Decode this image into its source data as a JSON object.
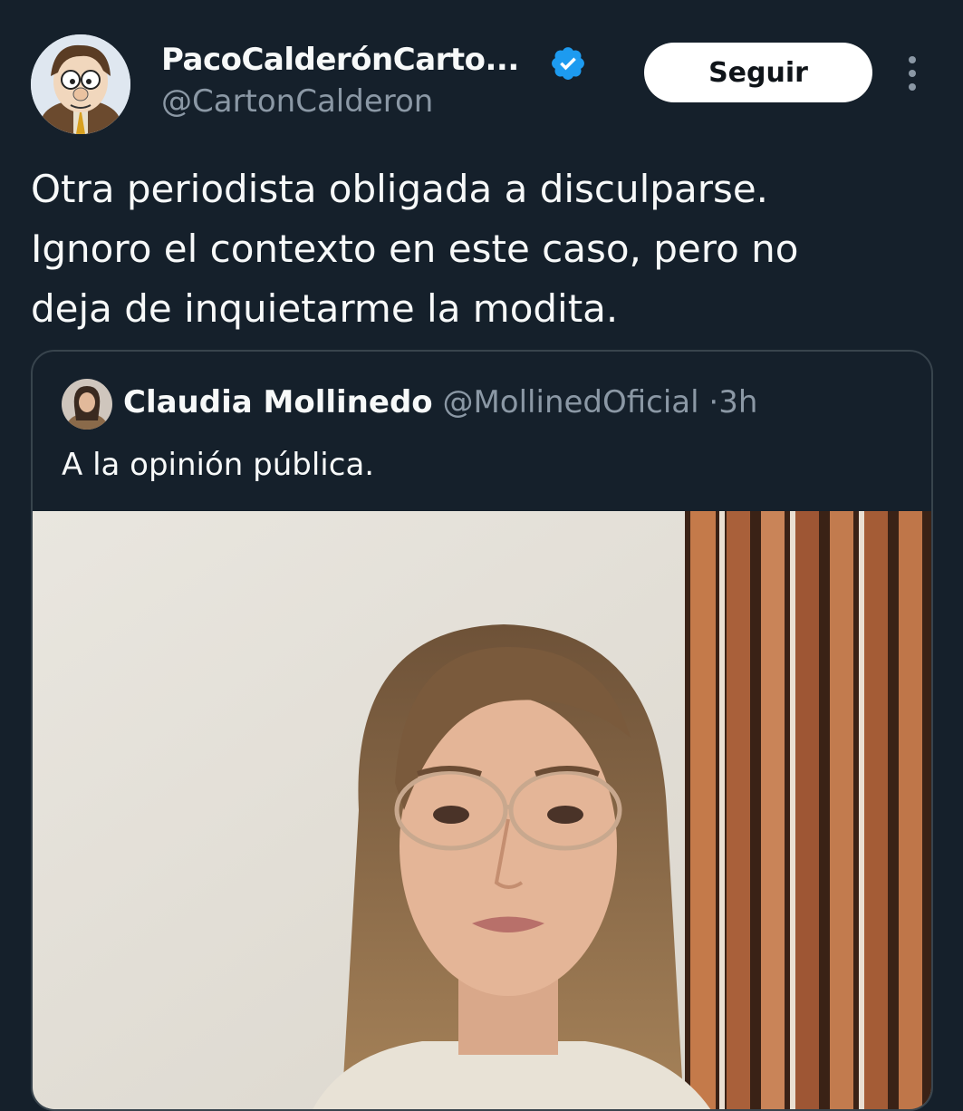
{
  "author": {
    "display_name": "PacoCalderónCarto...",
    "handle": "@CartonCalderon",
    "verified": true
  },
  "follow_button": {
    "label": "Seguir"
  },
  "more_button": {
    "icon": "more-vertical-icon"
  },
  "tweet": {
    "text_lines": [
      "Otra periodista obligada a disculparse.",
      "Ignoro el contexto en este caso, pero no",
      "deja de inquietarme la modita."
    ]
  },
  "quoted_tweet": {
    "display_name": "Claudia Mollinedo",
    "handle": "@MollinedOficial",
    "separator": "·",
    "time": "3h",
    "text": "A la opinión pública."
  },
  "colors": {
    "background": "#15202b",
    "verified_badge": "#1d9bf0",
    "secondary_text": "#8b98a5",
    "border": "#38444d"
  }
}
